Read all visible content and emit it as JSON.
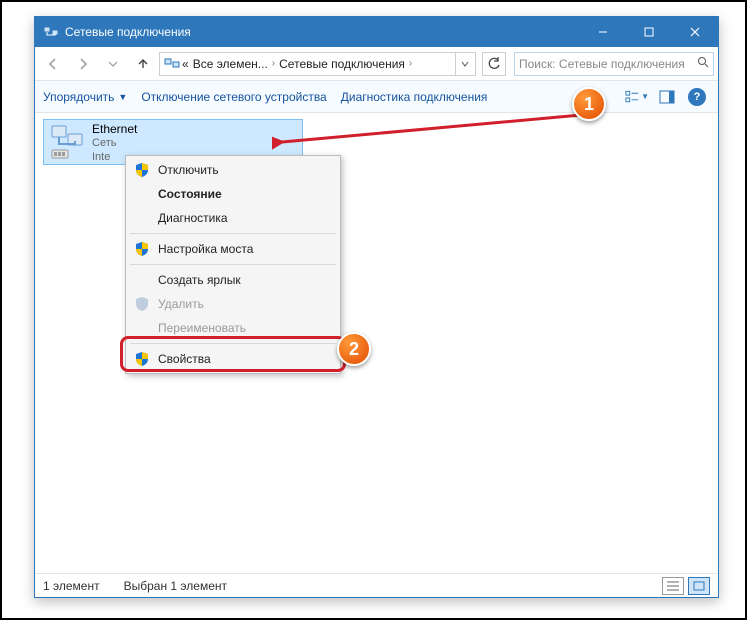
{
  "titlebar": {
    "title": "Сетевые подключения"
  },
  "breadcrumb": {
    "prefix": "«",
    "part1": "Все элемен...",
    "part2": "Сетевые подключения"
  },
  "search": {
    "placeholder": "Поиск: Сетевые подключения"
  },
  "toolbar": {
    "organize": "Упорядочить",
    "disable_device": "Отключение сетевого устройства",
    "diagnose": "Диагностика подключения"
  },
  "connection": {
    "name": "Ethernet",
    "line2": "Сеть",
    "line3": "Inte"
  },
  "context_menu": {
    "disable": "Отключить",
    "status": "Состояние",
    "diagnose": "Диагностика",
    "bridge": "Настройка моста",
    "shortcut": "Создать ярлык",
    "delete": "Удалить",
    "rename": "Переименовать",
    "properties": "Свойства"
  },
  "statusbar": {
    "count": "1 элемент",
    "selection": "Выбран 1 элемент"
  },
  "badges": {
    "one": "1",
    "two": "2"
  }
}
